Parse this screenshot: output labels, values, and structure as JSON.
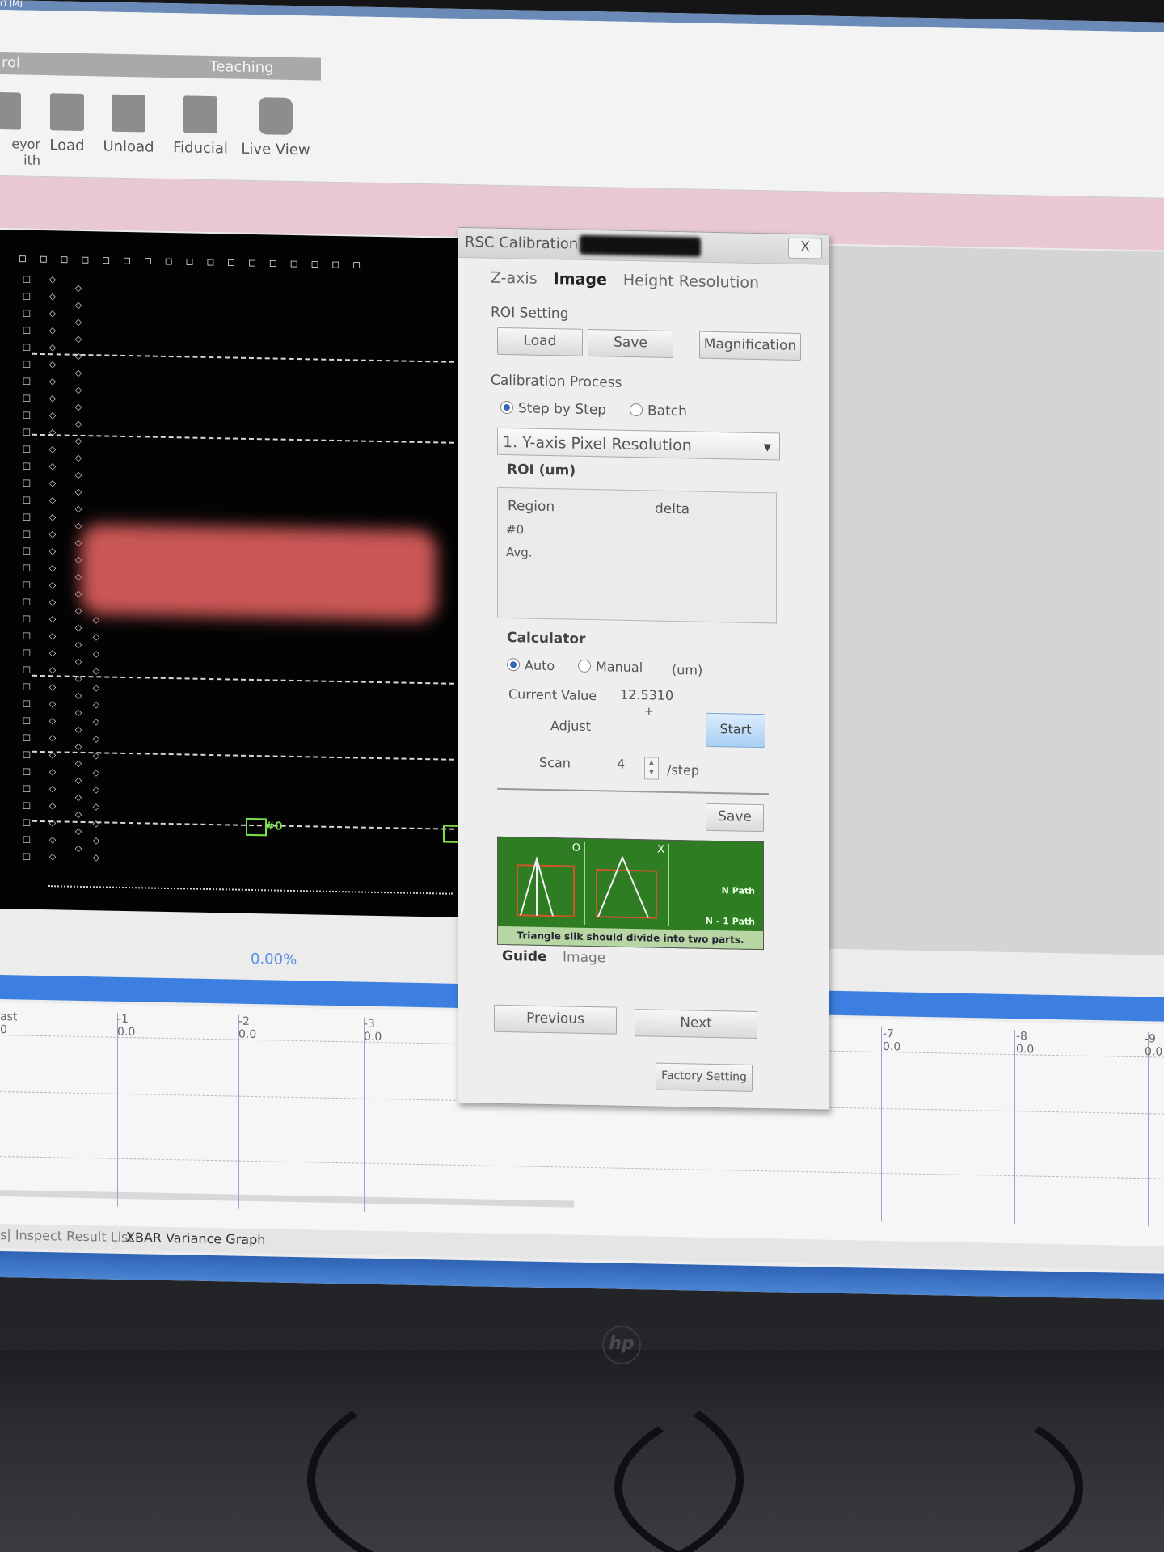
{
  "app": {
    "ribbon_groups": {
      "control": "rol",
      "teaching": "Teaching"
    },
    "ribbon_buttons": [
      {
        "label": "eyor\nith",
        "icon": "conveyor-icon"
      },
      {
        "label": "Load",
        "icon": "load-icon"
      },
      {
        "label": "Unload",
        "icon": "unload-icon"
      },
      {
        "label": "Fiducial",
        "icon": "fiducial-icon"
      },
      {
        "label": "Live View",
        "icon": "live-view-icon"
      }
    ],
    "viewport_marker": "#0",
    "progress_percent": "0.00%",
    "axis_ticks": [
      {
        "label": "ast",
        "val": "0"
      },
      {
        "label": "-1",
        "val": "0.0"
      },
      {
        "label": "-2",
        "val": "0.0"
      },
      {
        "label": "-3",
        "val": "0.0"
      },
      {
        "label": "-7",
        "val": "0.0"
      },
      {
        "label": "-8",
        "val": "0.0"
      },
      {
        "label": "-9",
        "val": "0.0"
      }
    ],
    "bottom_tabs": {
      "t1": "s| Inspect Result List",
      "t2": "XBAR Variance Graph"
    },
    "monitor_brand": "hp"
  },
  "dialog": {
    "title": "RSC Calibration",
    "close_label": "X",
    "tabs": {
      "z_axis": "Z-axis",
      "image": "Image",
      "height_resolution": "Height Resolution"
    },
    "roi_setting": {
      "label": "ROI Setting",
      "load": "Load",
      "save": "Save",
      "magnification": "Magnification"
    },
    "calibration_process": {
      "label": "Calibration Process",
      "step_by_step": "Step by Step",
      "batch": "Batch",
      "selected_mode": "Step by Step",
      "step_select": "1. Y-axis Pixel Resolution"
    },
    "roi": {
      "title": "ROI (um)",
      "col_region": "Region",
      "col_delta": "delta",
      "row0": "#0",
      "row_avg": "Avg."
    },
    "calculator": {
      "title": "Calculator",
      "auto": "Auto",
      "manual": "Manual",
      "unit": "(um)",
      "selected_mode": "Auto",
      "current_value_label": "Current Value",
      "current_value": "12.5310",
      "adjust_label": "Adjust",
      "adjust_sign": "+",
      "start": "Start",
      "scan_label": "Scan",
      "scan_value": "4",
      "scan_unit": "/step",
      "save": "Save"
    },
    "guide": {
      "caption": "Triangle silk should divide into two parts.",
      "n_path": "N Path",
      "n1_path": "N - 1 Path",
      "ok_mark": "O",
      "bad_mark": "X",
      "tab_guide": "Guide",
      "tab_image": "Image"
    },
    "nav": {
      "previous": "Previous",
      "next": "Next",
      "factory": "Factory Setting"
    }
  }
}
